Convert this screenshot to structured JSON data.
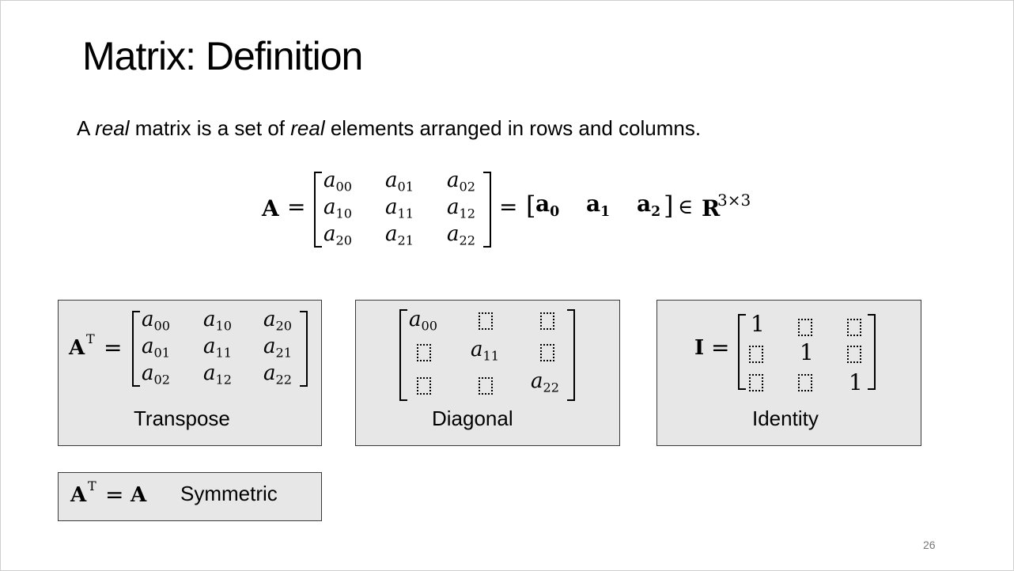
{
  "slide": {
    "title": "Matrix: Definition",
    "sentence": {
      "p1": "A ",
      "real1": "real",
      "p2": " matrix is a set of ",
      "real2": "real",
      "p3": " elements arranged in rows and columns."
    },
    "page_number": "26"
  },
  "main_equation": {
    "lhs": "A",
    "equals": "=",
    "entries": [
      [
        "a",
        "00"
      ],
      [
        "a",
        "01"
      ],
      [
        "a",
        "02"
      ],
      [
        "a",
        "10"
      ],
      [
        "a",
        "11"
      ],
      [
        "a",
        "12"
      ],
      [
        "a",
        "20"
      ],
      [
        "a",
        "21"
      ],
      [
        "a",
        "22"
      ]
    ],
    "columns": [
      [
        "a",
        "0"
      ],
      [
        "a",
        "1"
      ],
      [
        "a",
        "2"
      ]
    ],
    "member_of": "∈",
    "space": "R",
    "dimension": "3×3"
  },
  "boxes": {
    "transpose": {
      "lhs": "A",
      "sup": "T",
      "equals": "=",
      "entries": [
        [
          "a",
          "00"
        ],
        [
          "a",
          "10"
        ],
        [
          "a",
          "20"
        ],
        [
          "a",
          "01"
        ],
        [
          "a",
          "11"
        ],
        [
          "a",
          "21"
        ],
        [
          "a",
          "02"
        ],
        [
          "a",
          "12"
        ],
        [
          "a",
          "22"
        ]
      ],
      "caption": "Transpose"
    },
    "diagonal": {
      "entries": [
        [
          "a",
          "00"
        ],
        [
          "a",
          "11"
        ],
        [
          "a",
          "22"
        ]
      ],
      "caption": "Diagonal"
    },
    "identity": {
      "lhs": "I",
      "equals": "=",
      "one": "1",
      "caption": "Identity"
    },
    "symmetric": {
      "lhs": "A",
      "sup": "T",
      "equals": "=",
      "rhs": "A",
      "caption": "Symmetric"
    }
  }
}
